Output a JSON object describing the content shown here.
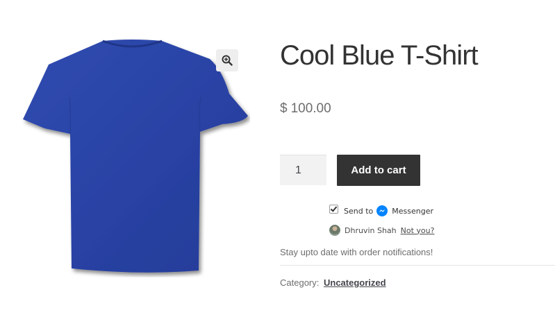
{
  "product": {
    "title": "Cool Blue T-Shirt",
    "currency": "$",
    "price": "100.00",
    "image_icon": "tshirt-image",
    "image_color": "#2a43a5"
  },
  "zoom": {
    "icon": "zoom-in-icon"
  },
  "cart_form": {
    "quantity": "1",
    "add_to_cart_label": "Add to cart",
    "button_color": "#333333"
  },
  "messenger": {
    "checked": true,
    "send_to_label": "Send to",
    "messenger_label": "Messenger",
    "icon": "messenger-icon",
    "icon_color": "#0084ff",
    "user_name": "Dhruvin Shah",
    "not_you_label": "Not you?"
  },
  "notifications_text": "Stay upto date with order notifications!",
  "meta": {
    "category_label": "Category:",
    "category_value": "Uncategorized"
  }
}
